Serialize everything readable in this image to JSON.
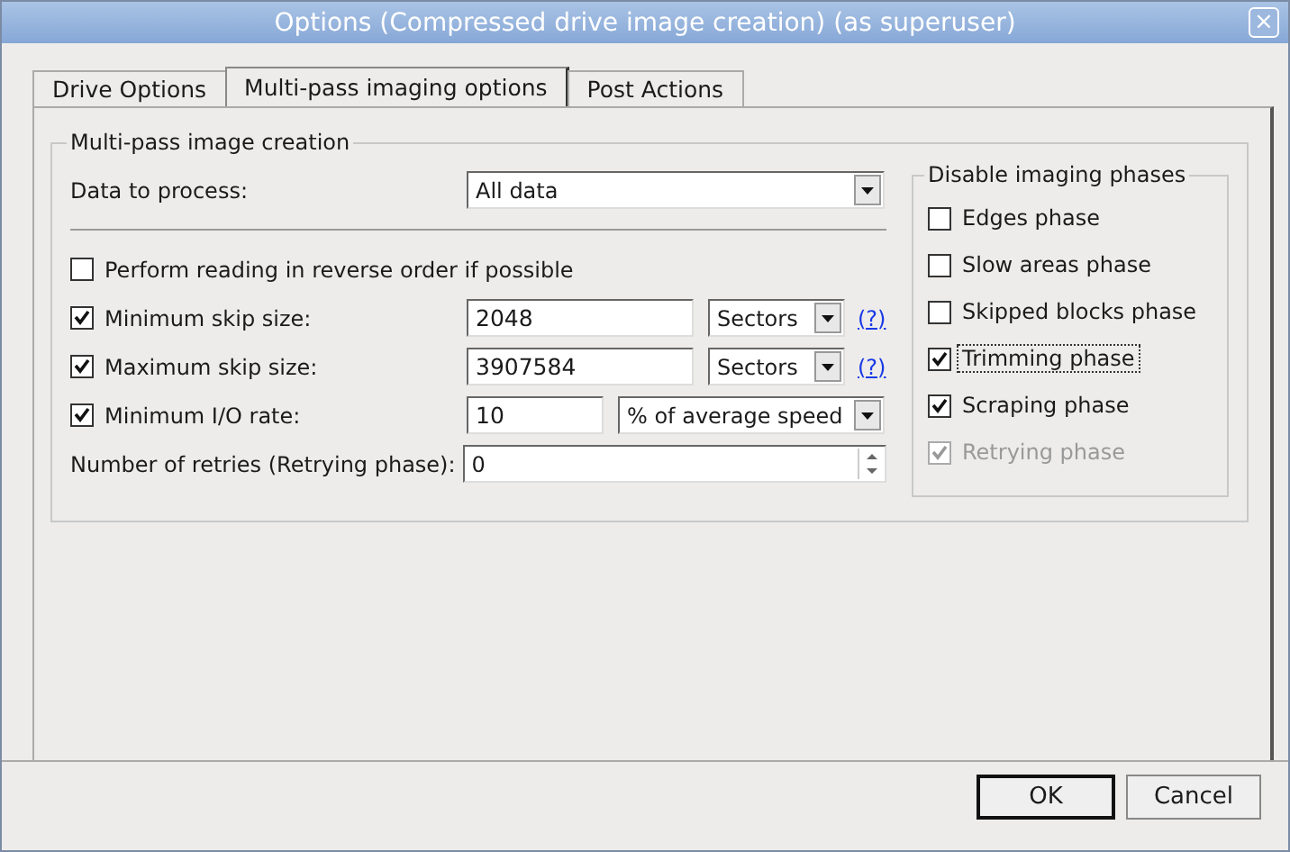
{
  "window": {
    "title": "Options (Compressed drive image creation) (as superuser)",
    "close": "×"
  },
  "tabs": [
    {
      "label": "Drive Options",
      "selected": false
    },
    {
      "label": "Multi-pass imaging options",
      "selected": true
    },
    {
      "label": "Post Actions",
      "selected": false
    }
  ],
  "group": {
    "title": "Multi-pass image creation",
    "data_to_process": {
      "label": "Data to process:",
      "value": "All data"
    },
    "rows": [
      {
        "kind": "check",
        "label": "Perform reading in reverse order if possible",
        "checked": false
      },
      {
        "kind": "unit",
        "label": "Minimum skip size:",
        "checked": true,
        "value": "2048",
        "unit": "Sectors",
        "help": "(?)"
      },
      {
        "kind": "unit",
        "label": "Maximum skip size:",
        "checked": true,
        "value": "3907584",
        "unit": "Sectors",
        "help": "(?)"
      },
      {
        "kind": "rate",
        "label": "Minimum I/O rate:",
        "checked": true,
        "value": "10",
        "unit": "% of average speed"
      },
      {
        "kind": "spin",
        "label": "Number of retries (Retrying phase):",
        "value": "0"
      }
    ]
  },
  "phases": {
    "title": "Disable imaging phases",
    "items": [
      {
        "label": "Edges phase",
        "checked": false,
        "disabled": false,
        "focused": false
      },
      {
        "label": "Slow areas phase",
        "checked": false,
        "disabled": false,
        "focused": false
      },
      {
        "label": "Skipped blocks phase",
        "checked": false,
        "disabled": false,
        "focused": false
      },
      {
        "label": "Trimming phase",
        "checked": true,
        "disabled": false,
        "focused": true
      },
      {
        "label": "Scraping phase",
        "checked": true,
        "disabled": false,
        "focused": false
      },
      {
        "label": "Retrying phase",
        "checked": true,
        "disabled": true,
        "focused": false
      }
    ]
  },
  "buttons": [
    {
      "label": "OK",
      "default": true
    },
    {
      "label": "Cancel",
      "default": false
    }
  ]
}
